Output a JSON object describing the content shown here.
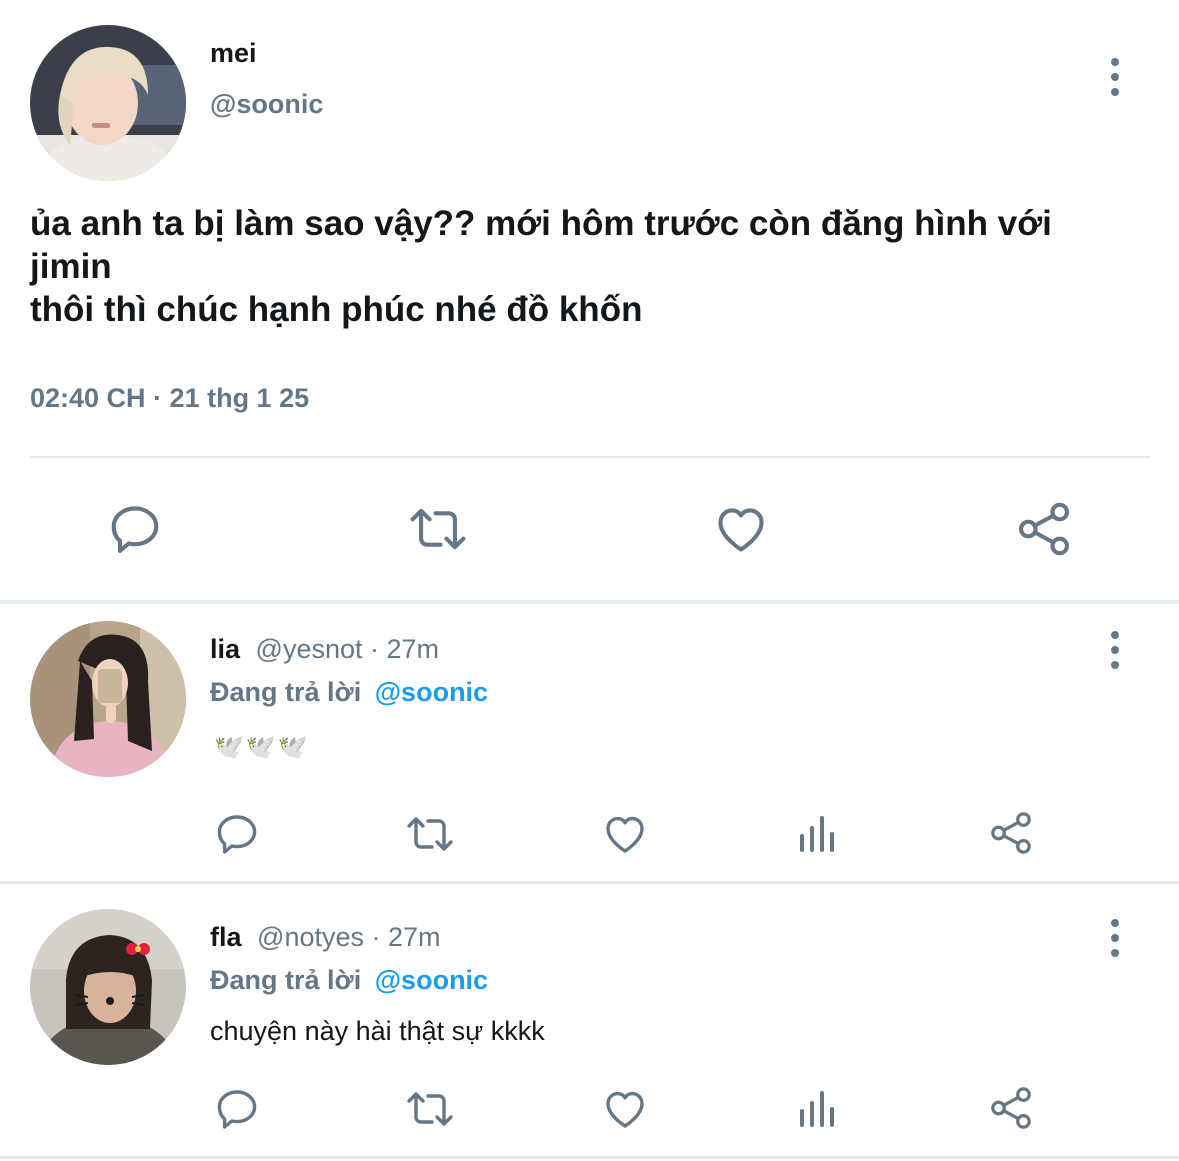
{
  "main_tweet": {
    "display_name": "mei",
    "handle": "@soonic",
    "text_lines": [
      "ủa anh ta bị làm sao vậy?? mới hôm trước còn đăng hình với",
      "jimin",
      "thôi thì chúc hạnh phúc nhé đồ khốn"
    ],
    "timestamp": "02:40 CH · 21 thg 1 25"
  },
  "replies": [
    {
      "display_name": "lia",
      "meta": "@yesnot · 27m",
      "replying_label": "Đang trả lời",
      "replying_to": "@soonic",
      "text": "🕊️🕊️🕊️"
    },
    {
      "display_name": "fla",
      "meta": "@notyes · 27m",
      "replying_label": "Đang trả lời",
      "replying_to": "@soonic",
      "text": "chuyện này hài thật sự kkkk"
    }
  ],
  "colors": {
    "icon": "#657786",
    "link": "#1d9bf0",
    "divider": "#e6ecf0"
  },
  "icons": [
    "comment-icon",
    "retweet-icon",
    "like-icon",
    "share-icon",
    "analytics-icon",
    "more-options-icon"
  ]
}
